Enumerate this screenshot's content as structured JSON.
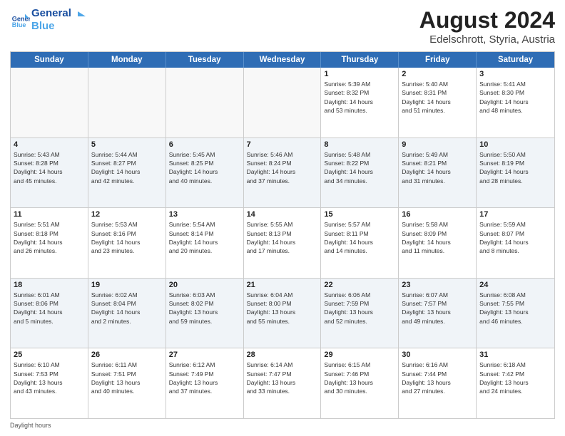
{
  "logo": {
    "line1": "General",
    "line2": "Blue"
  },
  "title": "August 2024",
  "subtitle": "Edelschrott, Styria, Austria",
  "days": [
    "Sunday",
    "Monday",
    "Tuesday",
    "Wednesday",
    "Thursday",
    "Friday",
    "Saturday"
  ],
  "footer": "Daylight hours",
  "weeks": [
    [
      {
        "day": "",
        "info": ""
      },
      {
        "day": "",
        "info": ""
      },
      {
        "day": "",
        "info": ""
      },
      {
        "day": "",
        "info": ""
      },
      {
        "day": "1",
        "info": "Sunrise: 5:39 AM\nSunset: 8:32 PM\nDaylight: 14 hours\nand 53 minutes."
      },
      {
        "day": "2",
        "info": "Sunrise: 5:40 AM\nSunset: 8:31 PM\nDaylight: 14 hours\nand 51 minutes."
      },
      {
        "day": "3",
        "info": "Sunrise: 5:41 AM\nSunset: 8:30 PM\nDaylight: 14 hours\nand 48 minutes."
      }
    ],
    [
      {
        "day": "4",
        "info": "Sunrise: 5:43 AM\nSunset: 8:28 PM\nDaylight: 14 hours\nand 45 minutes."
      },
      {
        "day": "5",
        "info": "Sunrise: 5:44 AM\nSunset: 8:27 PM\nDaylight: 14 hours\nand 42 minutes."
      },
      {
        "day": "6",
        "info": "Sunrise: 5:45 AM\nSunset: 8:25 PM\nDaylight: 14 hours\nand 40 minutes."
      },
      {
        "day": "7",
        "info": "Sunrise: 5:46 AM\nSunset: 8:24 PM\nDaylight: 14 hours\nand 37 minutes."
      },
      {
        "day": "8",
        "info": "Sunrise: 5:48 AM\nSunset: 8:22 PM\nDaylight: 14 hours\nand 34 minutes."
      },
      {
        "day": "9",
        "info": "Sunrise: 5:49 AM\nSunset: 8:21 PM\nDaylight: 14 hours\nand 31 minutes."
      },
      {
        "day": "10",
        "info": "Sunrise: 5:50 AM\nSunset: 8:19 PM\nDaylight: 14 hours\nand 28 minutes."
      }
    ],
    [
      {
        "day": "11",
        "info": "Sunrise: 5:51 AM\nSunset: 8:18 PM\nDaylight: 14 hours\nand 26 minutes."
      },
      {
        "day": "12",
        "info": "Sunrise: 5:53 AM\nSunset: 8:16 PM\nDaylight: 14 hours\nand 23 minutes."
      },
      {
        "day": "13",
        "info": "Sunrise: 5:54 AM\nSunset: 8:14 PM\nDaylight: 14 hours\nand 20 minutes."
      },
      {
        "day": "14",
        "info": "Sunrise: 5:55 AM\nSunset: 8:13 PM\nDaylight: 14 hours\nand 17 minutes."
      },
      {
        "day": "15",
        "info": "Sunrise: 5:57 AM\nSunset: 8:11 PM\nDaylight: 14 hours\nand 14 minutes."
      },
      {
        "day": "16",
        "info": "Sunrise: 5:58 AM\nSunset: 8:09 PM\nDaylight: 14 hours\nand 11 minutes."
      },
      {
        "day": "17",
        "info": "Sunrise: 5:59 AM\nSunset: 8:07 PM\nDaylight: 14 hours\nand 8 minutes."
      }
    ],
    [
      {
        "day": "18",
        "info": "Sunrise: 6:01 AM\nSunset: 8:06 PM\nDaylight: 14 hours\nand 5 minutes."
      },
      {
        "day": "19",
        "info": "Sunrise: 6:02 AM\nSunset: 8:04 PM\nDaylight: 14 hours\nand 2 minutes."
      },
      {
        "day": "20",
        "info": "Sunrise: 6:03 AM\nSunset: 8:02 PM\nDaylight: 13 hours\nand 59 minutes."
      },
      {
        "day": "21",
        "info": "Sunrise: 6:04 AM\nSunset: 8:00 PM\nDaylight: 13 hours\nand 55 minutes."
      },
      {
        "day": "22",
        "info": "Sunrise: 6:06 AM\nSunset: 7:59 PM\nDaylight: 13 hours\nand 52 minutes."
      },
      {
        "day": "23",
        "info": "Sunrise: 6:07 AM\nSunset: 7:57 PM\nDaylight: 13 hours\nand 49 minutes."
      },
      {
        "day": "24",
        "info": "Sunrise: 6:08 AM\nSunset: 7:55 PM\nDaylight: 13 hours\nand 46 minutes."
      }
    ],
    [
      {
        "day": "25",
        "info": "Sunrise: 6:10 AM\nSunset: 7:53 PM\nDaylight: 13 hours\nand 43 minutes."
      },
      {
        "day": "26",
        "info": "Sunrise: 6:11 AM\nSunset: 7:51 PM\nDaylight: 13 hours\nand 40 minutes."
      },
      {
        "day": "27",
        "info": "Sunrise: 6:12 AM\nSunset: 7:49 PM\nDaylight: 13 hours\nand 37 minutes."
      },
      {
        "day": "28",
        "info": "Sunrise: 6:14 AM\nSunset: 7:47 PM\nDaylight: 13 hours\nand 33 minutes."
      },
      {
        "day": "29",
        "info": "Sunrise: 6:15 AM\nSunset: 7:46 PM\nDaylight: 13 hours\nand 30 minutes."
      },
      {
        "day": "30",
        "info": "Sunrise: 6:16 AM\nSunset: 7:44 PM\nDaylight: 13 hours\nand 27 minutes."
      },
      {
        "day": "31",
        "info": "Sunrise: 6:18 AM\nSunset: 7:42 PM\nDaylight: 13 hours\nand 24 minutes."
      }
    ]
  ]
}
